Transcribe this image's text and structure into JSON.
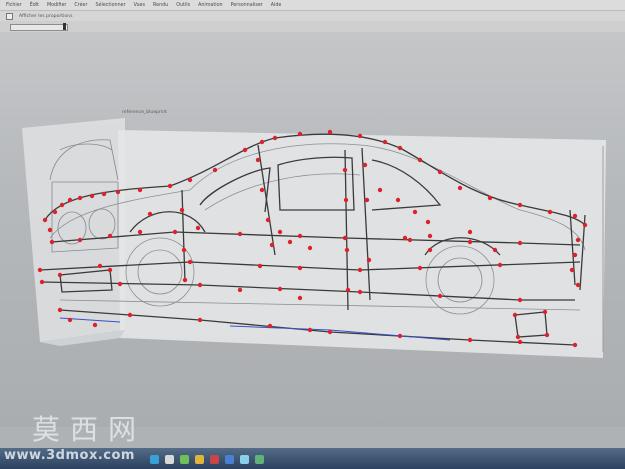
{
  "menu": {
    "items": [
      "Fichier",
      "Édit",
      "Modifier",
      "Créer",
      "Sélectionner",
      "Vues",
      "Rendu",
      "Outils",
      "Animation",
      "Personnaliser",
      "Aide"
    ]
  },
  "toolbar": {
    "option_label": "Afficher les proportions"
  },
  "viewport": {
    "reference_label": "reference_blueprint"
  },
  "watermark": {
    "main": "莫西网",
    "url": "www.3dmox.com"
  },
  "colors": {
    "vertex": "#d9232d",
    "wire": "#3a3a3a",
    "reference": "#7b7f84",
    "accent_blue": "#3b4fc9",
    "taskbar": "#2b4260"
  }
}
